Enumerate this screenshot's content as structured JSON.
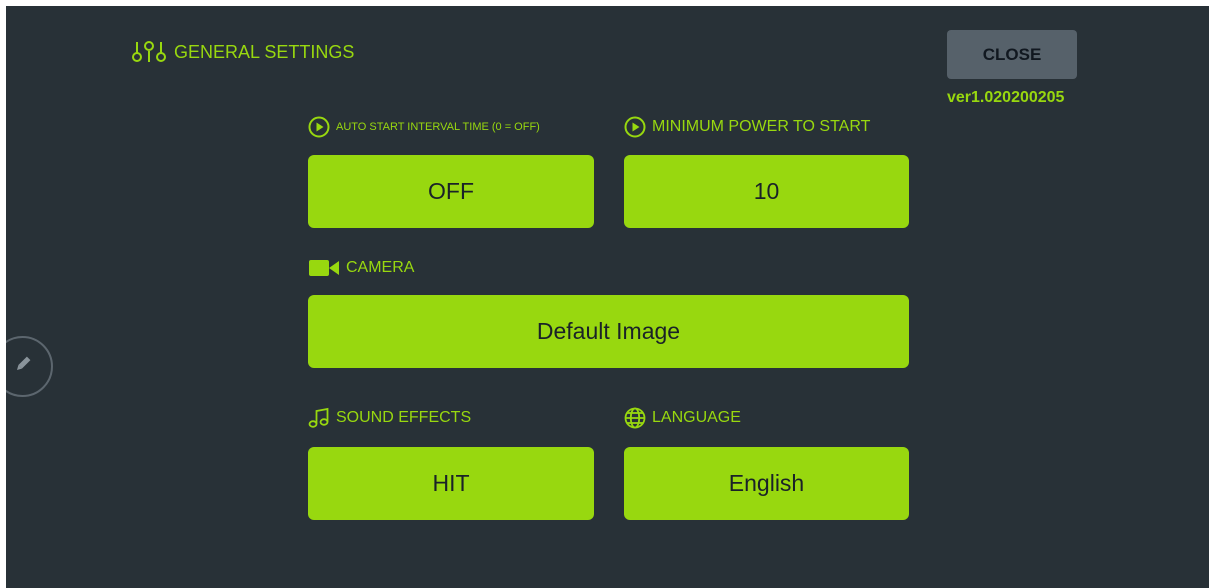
{
  "header": {
    "title": "GENERAL SETTINGS",
    "title_icon": "sliders-icon"
  },
  "close_button": {
    "label": "CLOSE"
  },
  "version": "ver1.020200205",
  "settings": {
    "auto_start": {
      "label": "AUTO START INTERVAL TIME (0 = OFF)",
      "value": "OFF",
      "icon": "play-circle-icon"
    },
    "min_power": {
      "label": "MINIMUM POWER TO START",
      "value": "10",
      "icon": "play-circle-icon"
    },
    "camera": {
      "label": "CAMERA",
      "value": "Default Image",
      "icon": "video-camera-icon"
    },
    "sound": {
      "label": "SOUND EFFECTS",
      "value": "HIT",
      "icon": "music-note-icon"
    },
    "language": {
      "label": "LANGUAGE",
      "value": "English",
      "icon": "globe-icon"
    }
  },
  "edit_button": {
    "icon": "pencil-icon"
  },
  "colors": {
    "background": "#283137",
    "accent": "#98d80f",
    "close_button_bg": "#56616a",
    "button_text": "#1a2228"
  }
}
